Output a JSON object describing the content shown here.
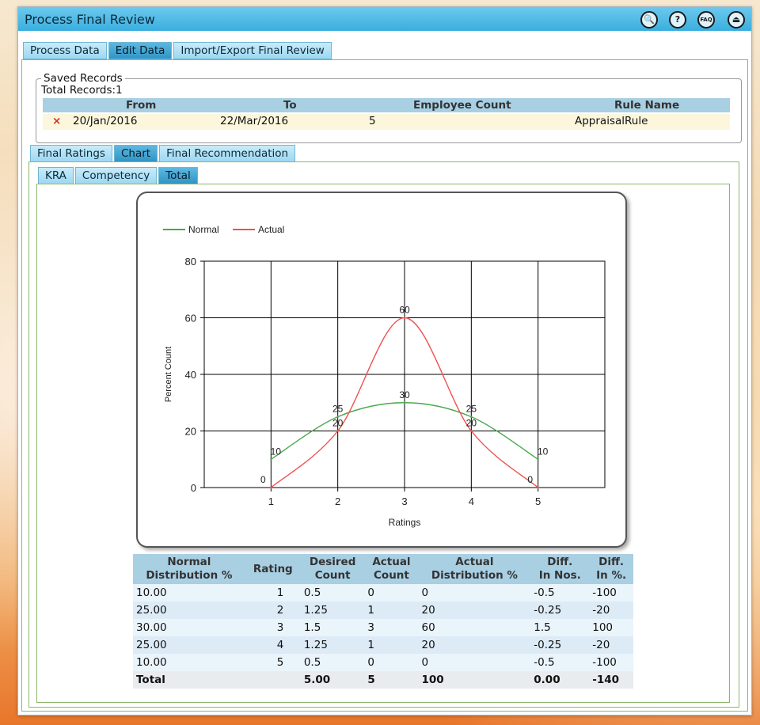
{
  "window": {
    "title": "Process Final Review"
  },
  "title_icons": [
    "search-icon",
    "help-icon",
    "faq-icon",
    "logout-icon"
  ],
  "title_icon_glyphs": {
    "search": "🔍",
    "help": "?",
    "faq": "FAQ",
    "logout": "⏏"
  },
  "main_tabs": [
    "Process Data",
    "Edit Data",
    "Import/Export Final Review"
  ],
  "saved_records": {
    "legend": "Saved Records",
    "total_label": "Total Records:1",
    "headers": {
      "from": "From",
      "to": "To",
      "employee_count": "Employee Count",
      "rule_name": "Rule Name"
    },
    "row": {
      "delete": "×",
      "from": "20/Jan/2016",
      "to": "22/Mar/2016",
      "employee_count": "5",
      "rule_name": "AppraisalRule"
    }
  },
  "sub_tabs": [
    "Final Ratings",
    "Chart",
    "Final Recommendation"
  ],
  "chart_tabs": [
    "KRA",
    "Competency",
    "Total"
  ],
  "chart_data": {
    "type": "line",
    "x": [
      1,
      2,
      3,
      4,
      5
    ],
    "series": [
      {
        "name": "Normal",
        "values": [
          10,
          25,
          30,
          25,
          10
        ],
        "color": "#4aa84a"
      },
      {
        "name": "Actual",
        "values": [
          0,
          20,
          60,
          20,
          0
        ],
        "color": "#f05050"
      }
    ],
    "xlabel": "Ratings",
    "ylabel": "Percent Count",
    "xticks": [
      "1",
      "2",
      "3",
      "4",
      "5"
    ],
    "yticks": [
      "0",
      "20",
      "40",
      "60",
      "80"
    ],
    "ylim": [
      0,
      80
    ],
    "xlim": [
      0,
      6
    ],
    "grid": true,
    "legend_position": "top-left",
    "data_labels": {
      "normal": [
        "10",
        "25",
        "30",
        "25",
        "10"
      ],
      "actual": [
        "0",
        "20",
        "60",
        "20",
        "0"
      ]
    }
  },
  "table": {
    "headers": [
      "Normal\nDistribution %",
      "Rating",
      "Desired\nCount",
      "Actual\nCount",
      "Actual\nDistribution %",
      "Diff.\nIn Nos.",
      "Diff.\nIn %."
    ],
    "rows": [
      [
        "10.00",
        "1",
        "0.5",
        "0",
        "0",
        "-0.5",
        "-100"
      ],
      [
        "25.00",
        "2",
        "1.25",
        "1",
        "20",
        "-0.25",
        "-20"
      ],
      [
        "30.00",
        "3",
        "1.5",
        "3",
        "60",
        "1.5",
        "100"
      ],
      [
        "25.00",
        "4",
        "1.25",
        "1",
        "20",
        "-0.25",
        "-20"
      ],
      [
        "10.00",
        "5",
        "0.5",
        "0",
        "0",
        "-0.5",
        "-100"
      ]
    ],
    "total": [
      "Total",
      "",
      "5.00",
      "5",
      "100",
      "0.00",
      "-140"
    ]
  }
}
